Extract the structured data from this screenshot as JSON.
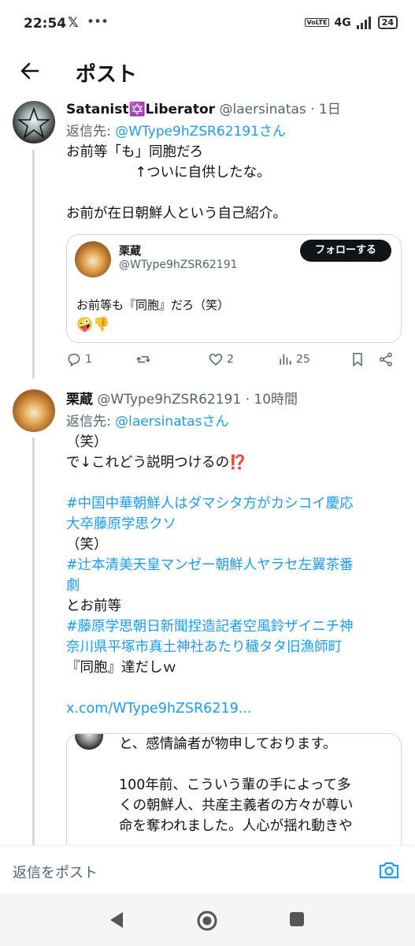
{
  "status_bar": {
    "time": "22:54",
    "x_label": "𝕏",
    "dots": "•••",
    "volte": "VoLTE",
    "network": "4G",
    "battery": "24"
  },
  "header": {
    "title": "ポスト"
  },
  "tweet1": {
    "name": "Satanist✡️Liberator",
    "handle_time": " @laersinatas · 1日",
    "reply_prefix": "返信先: ",
    "reply_to": "@WType9hZSR62191さん",
    "lines": [
      "お前等「も」同胞だろ",
      "　　　　　↑ついに自供したな。",
      "",
      "お前が在日朝鮮人という自己紹介。"
    ],
    "quote": {
      "name": "栗蔵",
      "handle": "@WType9hZSR62191",
      "follow_label": "フォローする",
      "text": "お前等も『同胞』だろ（笑）",
      "emoji": "🤪👎"
    },
    "actions": {
      "replies": "1",
      "retweets": "",
      "likes": "2",
      "views": "25"
    }
  },
  "tweet2": {
    "name": "栗蔵",
    "handle_time": " @WType9hZSR62191 · 10時間",
    "reply_prefix": "返信先: ",
    "reply_to": "@laersinatasさん",
    "lines": [
      {
        "text": "（笑）",
        "link": false
      },
      {
        "text": "で↓これどう説明つけるの⁉️",
        "link": false
      },
      {
        "text": "",
        "link": false
      },
      {
        "text": "#中国中華朝鮮人はダマシタ方がカシコイ慶応",
        "link": true
      },
      {
        "text": "大卒藤原学思クソ",
        "link": true
      },
      {
        "text": "（笑）",
        "link": false
      },
      {
        "text": "#辻本清美天皇マンゼー朝鮮人ヤラセ左翼茶番",
        "link": true
      },
      {
        "text": "劇",
        "link": true
      },
      {
        "text": "とお前等",
        "link": false
      },
      {
        "text": "#藤原学思朝日新聞捏造記者空風鈴ザイニチ神",
        "link": true
      },
      {
        "text": "奈川県平塚市真土神社あたり穢タタ旧漁師町",
        "link": true
      },
      {
        "text": "『同胞』達だしｗ",
        "link": false
      },
      {
        "text": "",
        "link": false
      },
      {
        "text": "x.com/WType9hZSR6219...",
        "link": true
      }
    ],
    "embed_lines": [
      "と、感情論者が物申しております。",
      "",
      "100年前、こういう輩の手によって多",
      "くの朝鮮人、共産主義者の方々が尊い",
      "命を奪われました。人心が揺れ動きや"
    ]
  },
  "reply_bar": {
    "placeholder": "返信をポスト"
  }
}
